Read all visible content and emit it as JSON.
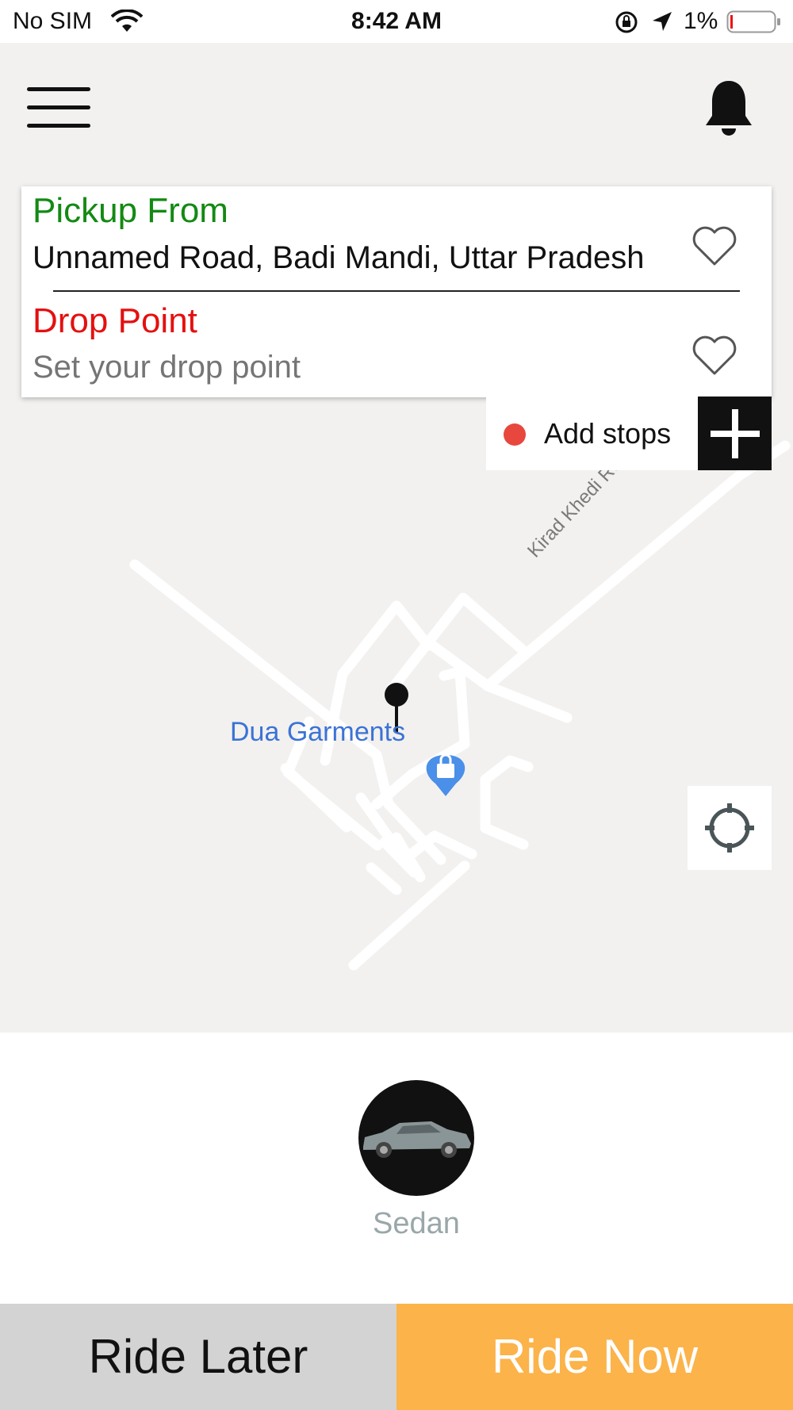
{
  "status_bar": {
    "carrier": "No SIM",
    "time": "8:42 AM",
    "battery_percent": "1%"
  },
  "header": {
    "menu_icon": "hamburger-menu-icon",
    "notification_icon": "bell-icon"
  },
  "location_card": {
    "pickup_label": "Pickup From",
    "pickup_value": "Unnamed Road, Badi Mandi, Uttar Pradesh",
    "drop_label": "Drop Point",
    "drop_placeholder": "Set your drop point",
    "favorite_icon": "heart-outline-icon"
  },
  "add_stops": {
    "label": "Add stops",
    "dot_color": "#e8473e"
  },
  "map": {
    "poi_label": "Dua Garments",
    "road_label": "Kirad Khedi Road"
  },
  "vehicle": {
    "label": "Sedan"
  },
  "actions": {
    "ride_later": "Ride Later",
    "ride_now": "Ride Now"
  },
  "colors": {
    "pickup": "#138a13",
    "drop": "#e41010",
    "ride_now_bg": "#fbb34a",
    "ride_later_bg": "#d3d3d3"
  }
}
